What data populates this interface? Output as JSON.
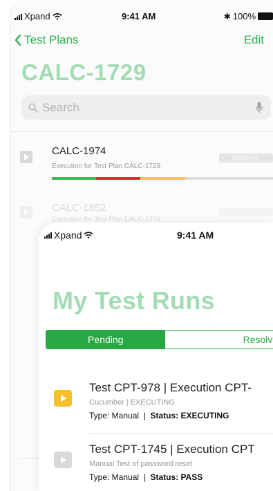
{
  "back_screen": {
    "status": {
      "carrier": "Xpand",
      "time": "9:41 AM",
      "battery": "100%"
    },
    "nav": {
      "back_label": "Test Plans",
      "edit_label": "Edit"
    },
    "title": "CALC-1729",
    "search": {
      "placeholder": "Search"
    },
    "rows": [
      {
        "title": "CALC-1974",
        "subtitle": "Execution for Test Plan CALC-1729",
        "badge": "PENDING",
        "progress": [
          {
            "fraction": 0.2,
            "color": "#3cba54"
          },
          {
            "fraction": 0.2,
            "color": "#e32636"
          },
          {
            "fraction": 0.2,
            "color": "#f7c948"
          },
          {
            "fraction": 0.4,
            "color": "#dddddd"
          }
        ]
      },
      {
        "title": "CALC-1852",
        "subtitle": "Execution for Test Plan CALC-1729"
      }
    ]
  },
  "front_screen": {
    "status": {
      "carrier": "Xpand",
      "time": "9:41 AM"
    },
    "title": "My Test Runs",
    "segments": {
      "active": "Pending",
      "inactive": "Resolved"
    },
    "runs": [
      {
        "title": "Test CPT-978 | Execution CPT-",
        "subtitle": "Cucumber | EXECUTING",
        "type_label": "Type: Manual",
        "status_label": "Status: EXECUTING",
        "icon_color": "#f7c02b"
      },
      {
        "title": "Test CPT-1745 | Execution CPT",
        "subtitle": "Manual Test of password reset",
        "type_label": "Type: Manual",
        "status_label": "Status: PASS",
        "icon_color": "#d9d9d9"
      }
    ]
  },
  "colors": {
    "accent_green": "#2eb24e",
    "title_green_light": "#a3dcb3",
    "segment_green": "#26a843"
  }
}
